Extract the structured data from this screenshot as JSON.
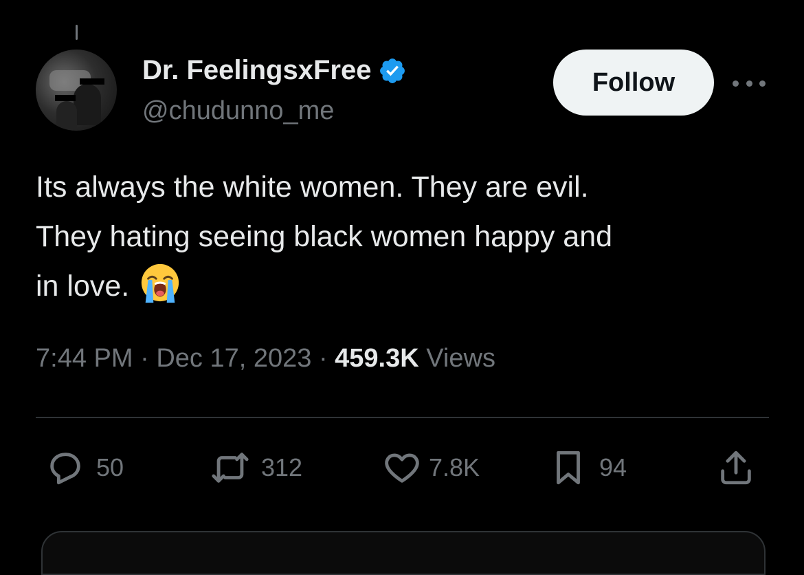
{
  "user": {
    "display_name": "Dr. FeelingsxFree",
    "handle": "@chudunno_me",
    "verified": true
  },
  "header": {
    "follow_label": "Follow",
    "more_icon": "more-icon"
  },
  "tweet": {
    "lines": [
      "Its always the white women. They are evil.",
      "They hating seeing black women happy and",
      "in love."
    ],
    "emoji": "loudly-crying-face"
  },
  "meta": {
    "time": "7:44 PM",
    "separator": "·",
    "date": "Dec 17, 2023",
    "views_count": "459.3K",
    "views_label": "Views"
  },
  "actions": {
    "replies": "50",
    "reposts": "312",
    "likes": "7.8K",
    "bookmarks": "94"
  },
  "colors": {
    "background": "#000000",
    "text": "#e7e9ea",
    "muted": "#71767b",
    "verified": "#1d9bf0",
    "divider": "#2f3336"
  }
}
